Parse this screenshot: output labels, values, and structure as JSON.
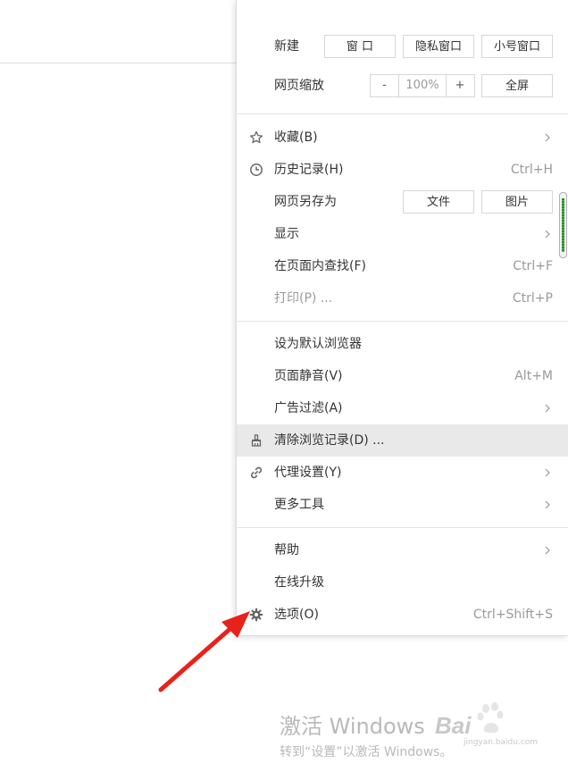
{
  "menu": {
    "new": {
      "label": "新建",
      "window": "窗 口",
      "private": "隐私窗口",
      "small": "小号窗口"
    },
    "zoom": {
      "label": "网页缩放",
      "minus": "-",
      "value": "100%",
      "plus": "+",
      "fullscreen": "全屏"
    },
    "favorites": {
      "label": "收藏(B)"
    },
    "history": {
      "label": "历史记录(H)",
      "shortcut": "Ctrl+H"
    },
    "save_as": {
      "label": "网页另存为",
      "file": "文件",
      "image": "图片"
    },
    "display": {
      "label": "显示"
    },
    "find": {
      "label": "在页面内查找(F)",
      "shortcut": "Ctrl+F"
    },
    "print": {
      "label": "打印(P) ...",
      "shortcut": "Ctrl+P",
      "disabled": true
    },
    "default_browser": {
      "label": "设为默认浏览器"
    },
    "mute": {
      "label": "页面静音(V)",
      "shortcut": "Alt+M"
    },
    "adblock": {
      "label": "广告过滤(A)"
    },
    "clear_history": {
      "label": "清除浏览记录(D) ...",
      "hovered": true
    },
    "proxy": {
      "label": "代理设置(Y)"
    },
    "more_tools": {
      "label": "更多工具"
    },
    "help": {
      "label": "帮助"
    },
    "upgrade": {
      "label": "在线升级"
    },
    "options": {
      "label": "选项(O)",
      "shortcut": "Ctrl+Shift+S"
    }
  },
  "watermark": {
    "title": "激活 Windows",
    "subtitle": "转到“设置”以激活 Windows。",
    "logo_text": "Bai",
    "logo_sub": "jingyan.baidu.com"
  },
  "colors": {
    "arrow": "#e8221b",
    "hover_row": "#e9e9e9",
    "text": "#333333",
    "muted": "#9a9a9a"
  }
}
